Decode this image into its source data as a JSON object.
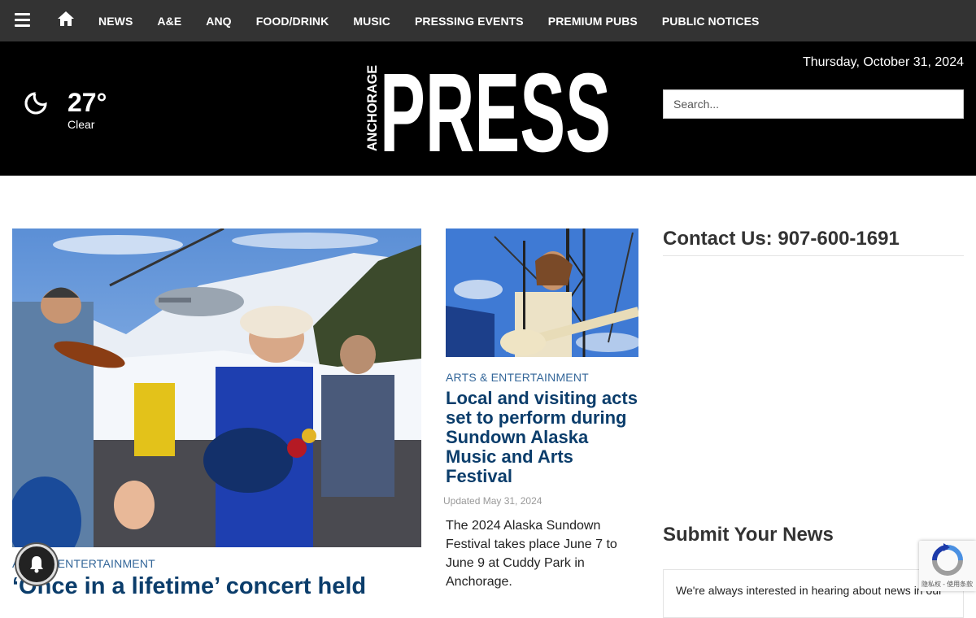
{
  "nav": {
    "items": [
      "NEWS",
      "A&E",
      "ANQ",
      "FOOD/DRINK",
      "MUSIC",
      "PRESSING EVENTS",
      "PREMIUM PUBS",
      "PUBLIC NOTICES"
    ]
  },
  "weather": {
    "temp": "27°",
    "condition": "Clear",
    "icon": "moon-icon"
  },
  "header": {
    "logo_small": "ANCHORAGE",
    "logo_big": "PRESS",
    "date": "Thursday, October 31, 2024"
  },
  "search": {
    "placeholder": "Search..."
  },
  "feature": {
    "category": "ARTS & ENTERTAINMENT",
    "title": "‘Once in a lifetime’ concert held"
  },
  "article": {
    "category": "ARTS & ENTERTAINMENT",
    "title": "Local and visiting acts set to perform during Sundown Alaska Music and Arts Festival",
    "updated": "Updated May 31, 2024",
    "description": "The 2024 Alaska Sundown Festival takes place June 7 to June 9 at Cuddy Park in Anchorage."
  },
  "sidebar": {
    "contact": "Contact Us: 907-600-1691",
    "submit_heading": "Submit Your News",
    "submit_text": "We're always interested in hearing about news in our"
  },
  "recaptcha": {
    "text": "隐私权 - 使用条款"
  },
  "colors": {
    "nav_bg": "#333333",
    "header_bg": "#000000",
    "link_blue": "#0b3d6b",
    "category_blue": "#336699"
  }
}
